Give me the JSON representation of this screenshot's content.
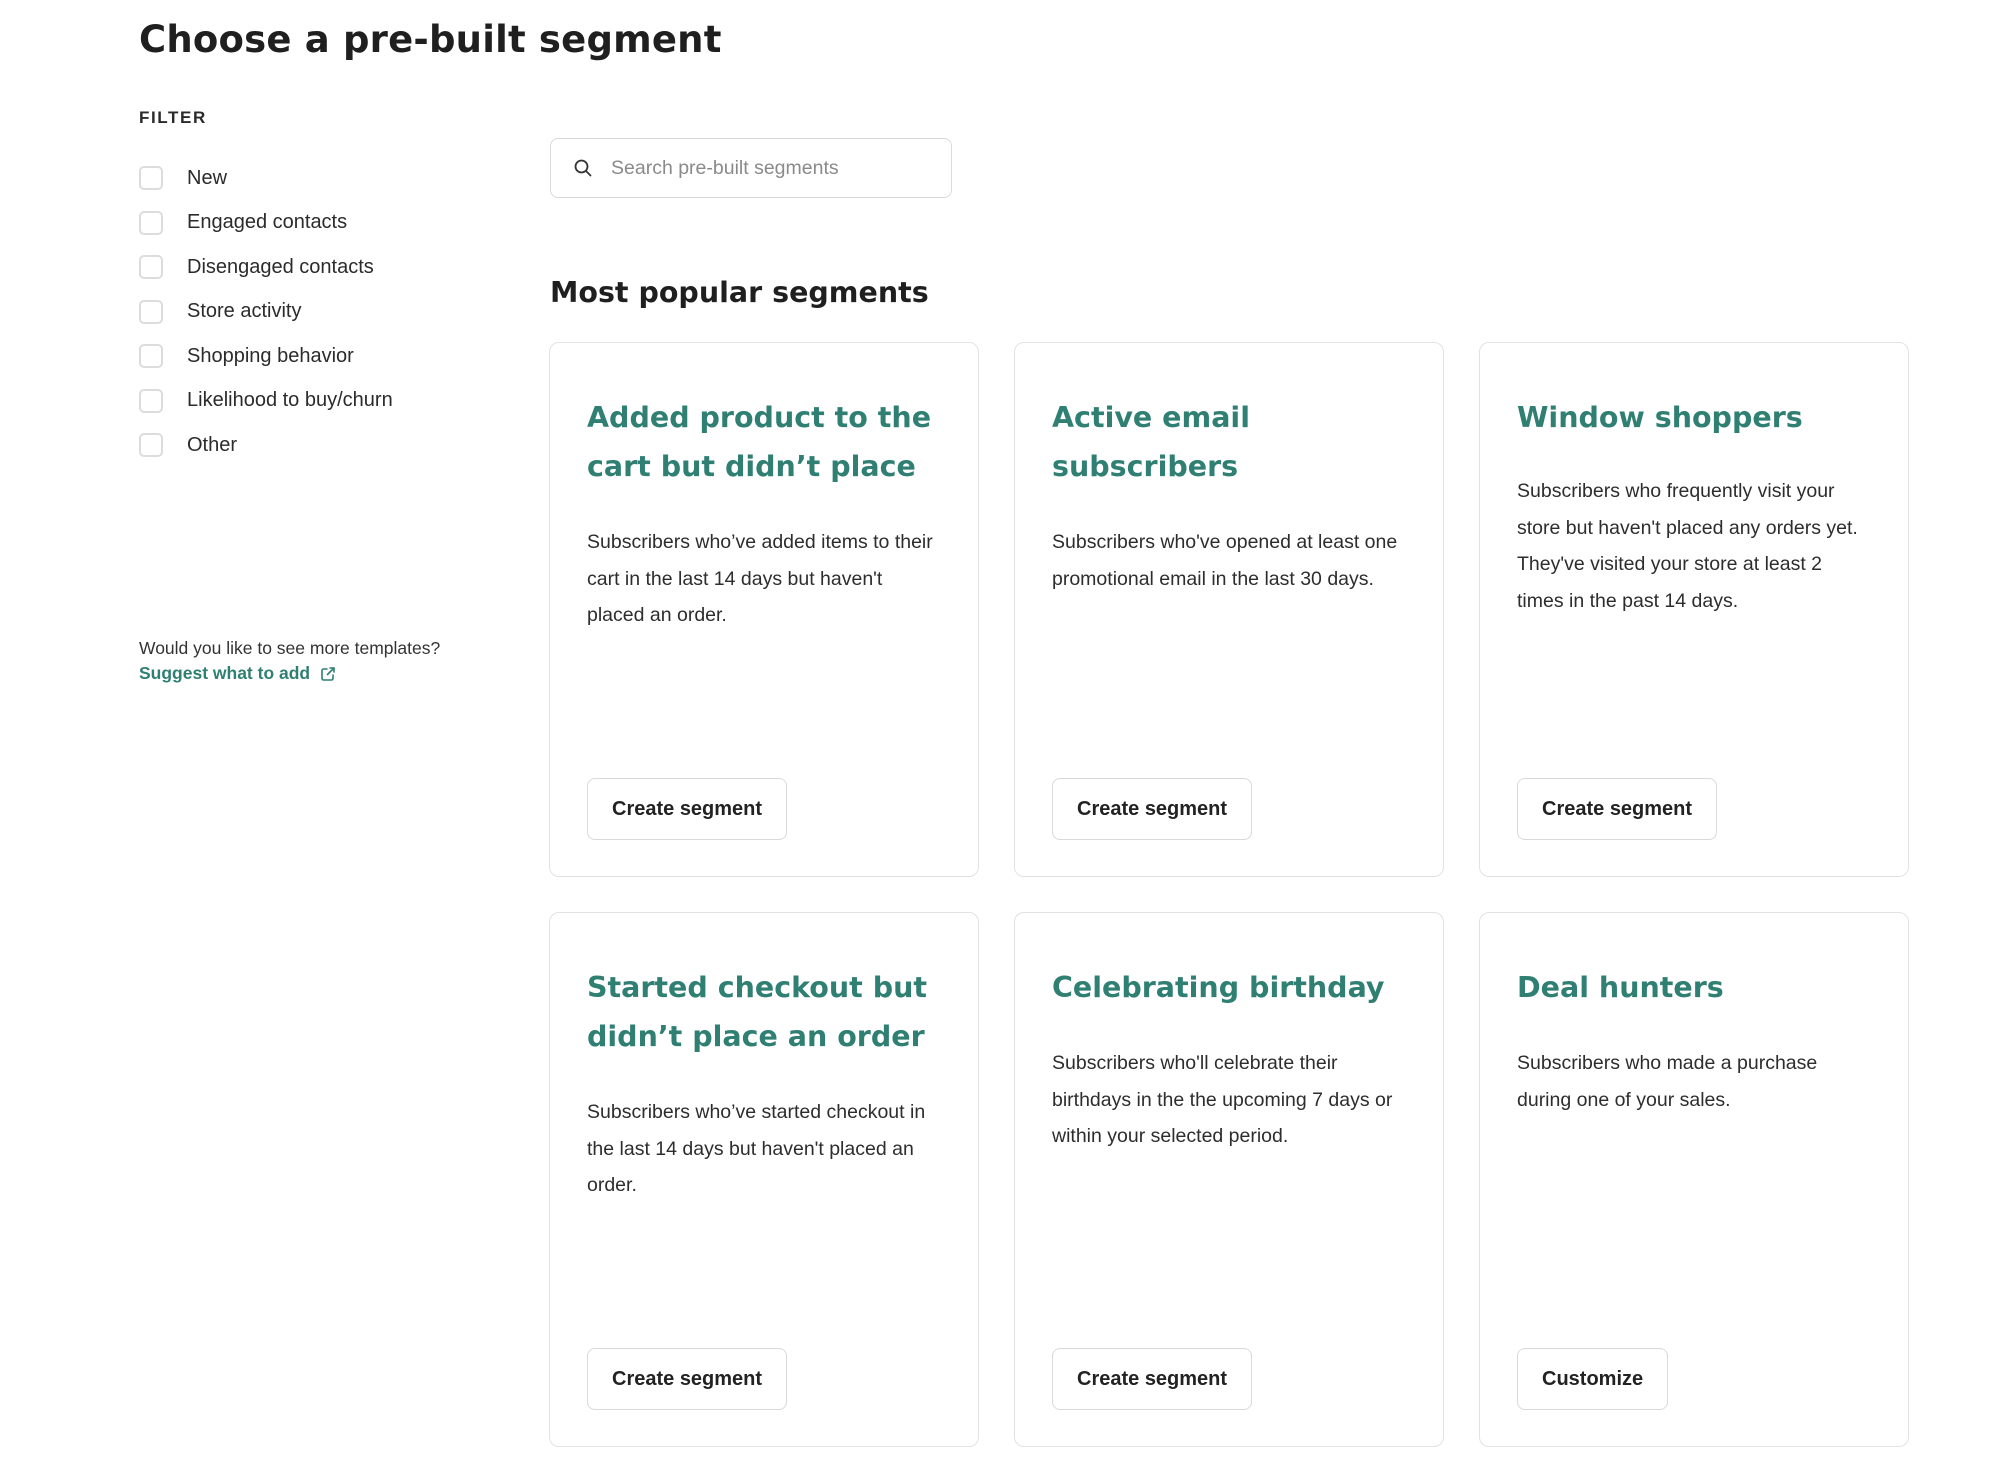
{
  "page": {
    "title": "Choose a pre-built segment"
  },
  "sidebar": {
    "filter_label": "FILTER",
    "filters": [
      {
        "label": "New",
        "checked": false
      },
      {
        "label": "Engaged contacts",
        "checked": false
      },
      {
        "label": "Disengaged contacts",
        "checked": false
      },
      {
        "label": "Store activity",
        "checked": false
      },
      {
        "label": "Shopping behavior",
        "checked": false
      },
      {
        "label": "Likelihood to buy/churn",
        "checked": false
      },
      {
        "label": "Other",
        "checked": false
      }
    ],
    "more_templates_text": "Would you like to see more templates?",
    "suggest_link": "Suggest what to add",
    "suggest_icon": "external-link-icon"
  },
  "search": {
    "placeholder": "Search pre-built segments",
    "value": "",
    "icon": "search-icon"
  },
  "main": {
    "section_title": "Most popular segments",
    "cards": [
      {
        "title": "Added product to the cart but didn’t place an order",
        "description": "Subscribers who’ve added items to their cart in the last 14 days but haven't placed an order.",
        "button": "Create segment"
      },
      {
        "title": "Active email subscribers",
        "description": "Subscribers who've opened at least one promotional email in the last 30 days.",
        "button": "Create segment"
      },
      {
        "title": "Window shoppers",
        "description": "Subscribers who frequently visit your store but haven't placed any orders yet. They've visited your store at least 2 times in the past 14 days.",
        "button": "Create segment"
      },
      {
        "title": "Started checkout but didn’t place an order",
        "description": "Subscribers who’ve started checkout in the last 14 days but haven't placed an order.",
        "button": "Create segment"
      },
      {
        "title": "Celebrating birthday",
        "description": "Subscribers who'll celebrate their birthdays in the the upcoming 7 days or within your selected period.",
        "button": "Create segment"
      },
      {
        "title": "Deal hunters",
        "description": "Subscribers who made a purchase during one of your sales.",
        "button": "Customize"
      }
    ]
  },
  "colors": {
    "accent": "#2f7f73",
    "border": "#e2e2e2",
    "text": "#222222"
  }
}
